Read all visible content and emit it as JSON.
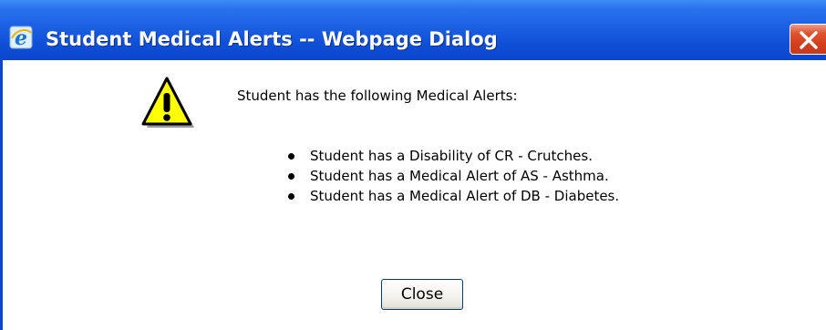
{
  "window": {
    "title": "Student Medical Alerts -- Webpage Dialog",
    "title_icon": "internet-explorer-icon",
    "close_icon": "close-icon"
  },
  "dialog": {
    "icon": "warning-icon",
    "heading": "Student has the following Medical Alerts:",
    "alerts": [
      "Student has a Disability of CR - Crutches.",
      "Student has a Medical Alert of AS - Asthma.",
      "Student has a Medical Alert of DB - Diabetes."
    ],
    "close_label": "Close"
  },
  "colors": {
    "titlebar": "#0f4fd6",
    "close_button_titlebar": "#d23d1c",
    "warning": "#ffff00"
  }
}
